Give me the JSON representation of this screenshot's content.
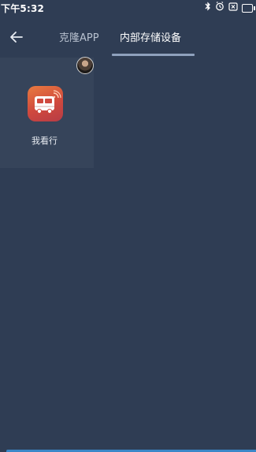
{
  "status_bar": {
    "time": "下午5:32",
    "icons": [
      "bluetooth-icon",
      "alarm-icon",
      "sim-off-icon",
      "battery-icon"
    ]
  },
  "header": {
    "back_icon": "arrow-left-icon",
    "tabs": [
      {
        "label": "克隆APP",
        "active": false
      },
      {
        "label": "内部存储设备",
        "active": true
      }
    ]
  },
  "apps": [
    {
      "name": "我看行",
      "icon": "bus-app-icon"
    }
  ],
  "colors": {
    "background": "#2f3d54",
    "tile": "#36445a",
    "tab_indicator": "#8fa1bd",
    "app_icon_orange": "#e97b3f",
    "app_icon_red": "#c4423f"
  }
}
